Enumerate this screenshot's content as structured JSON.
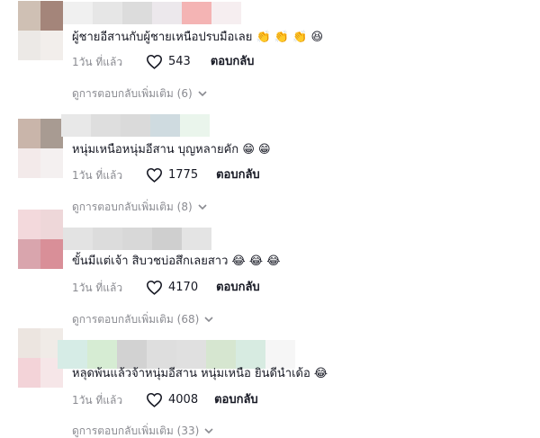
{
  "comments": [
    {
      "avatar_colors": [
        "#cfc0b4",
        "#a4857a",
        "#ece9e6",
        "#f2eeeb"
      ],
      "username_blocks": [
        "#f0f0f0",
        "#e6e6e6",
        "#dcdcdc",
        "#ece8ec",
        "#f4b4b4",
        "#f6eef0"
      ],
      "text": "ผู้ชายอีสานกับผู้ชายเหนือปรบมือเลย",
      "emojis": "👏 👏 👏 😆",
      "time": "1วัน ที่แล้ว",
      "likes": "543",
      "reply_label": "ตอบกลับ",
      "more_replies": "ดูการตอบกลับเพิ่มเติม (6)"
    },
    {
      "avatar_colors": [
        "#c9b5aa",
        "#a89b92",
        "#f3eaea",
        "#f4f0f0"
      ],
      "username_blocks": [
        "#e8e8e8",
        "#dedede",
        "#dadada",
        "#cfdbe0",
        "#eaf5ec"
      ],
      "text": "หนุ่มเหนือหนุ่มอีสาน บุญหลายคัก",
      "emojis": "😁 😁",
      "time": "1วัน ที่แล้ว",
      "likes": "1775",
      "reply_label": "ตอบกลับ",
      "more_replies": "ดูการตอบกลับเพิ่มเติม (8)"
    },
    {
      "avatar_colors": [
        "#f3d9dc",
        "#eed7d9",
        "#d9a5ad",
        "#d98f98"
      ],
      "username_blocks": [
        "#e3e3e3",
        "#dcdcdc",
        "#d8d8d8",
        "#cfcfcf",
        "#e4e4e4"
      ],
      "text": "ขั้นมีแต่เจ้า สิบวชบ่อสึกเลยสาว",
      "emojis": "😂 😂 😂",
      "time": "1วัน ที่แล้ว",
      "likes": "4170",
      "reply_label": "ตอบกลับ",
      "more_replies": "ดูการตอบกลับเพิ่มเติม (68)"
    },
    {
      "avatar_colors": [
        "#ece5e0",
        "#f0ebe7",
        "#f3d3d8",
        "#f6e6e8"
      ],
      "username_blocks": [
        "#d6ece6",
        "#d6ecd3",
        "#d2d2d2",
        "#dedede",
        "#e0e0e0",
        "#d6e6d0",
        "#d7ebe1",
        "#f6f6f6"
      ],
      "text": "หลุดพ้นแล้วจ้าหนุ่มอีสาน หนุ่มเหนือ ยินดีนำเด้อ",
      "emojis": "😂",
      "time": "1วัน ที่แล้ว",
      "likes": "4008",
      "reply_label": "ตอบกลับ",
      "more_replies": "ดูการตอบกลับเพิ่มเติม (33)"
    }
  ]
}
